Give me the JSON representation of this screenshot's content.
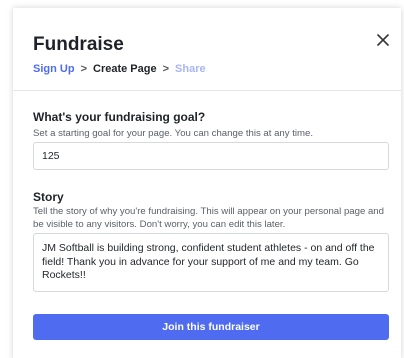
{
  "modal": {
    "title": "Fundraise",
    "close_icon": "close-icon"
  },
  "breadcrumb": {
    "steps": [
      "Sign Up",
      "Create Page",
      "Share"
    ],
    "separator": ">",
    "colors": {
      "active": "#4f6cf0",
      "current": "#1f2329",
      "upcoming": "#a8b6f5"
    }
  },
  "goal": {
    "label": "What's your fundraising goal?",
    "help": "Set a starting goal for your page. You can change this at any time.",
    "value": "125"
  },
  "story": {
    "label": "Story",
    "help": "Tell the story of why you're fundraising. This will appear on your personal page and be visible to any visitors. Don't worry, you can edit this later.",
    "value": "JM Softball is building strong, confident student athletes - on and off the field!  Thank you in advance for your support of me and my team.  Go Rockets!!"
  },
  "submit": {
    "label": "Join this fundraiser",
    "color": "#4f6cf0"
  }
}
